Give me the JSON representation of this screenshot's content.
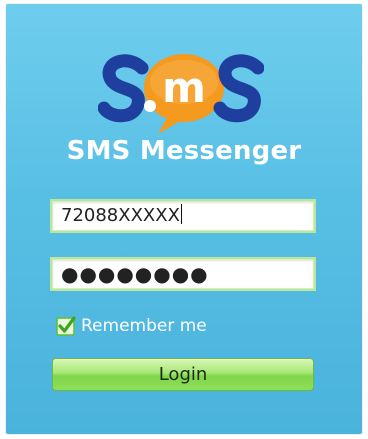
{
  "app": {
    "title": "SMS Messenger",
    "logo_text": "S.mS"
  },
  "login_form": {
    "phone_value": "72088XXXXX",
    "password_masked": "●●●●●●●●",
    "remember_label": "Remember me",
    "remember_checked": true,
    "login_label": "Login"
  },
  "colors": {
    "background": "#58bfe4",
    "logo_dark_blue": "#1f3f9e",
    "logo_orange": "#f49a1e",
    "button_green": "#8fde5a",
    "checkbox_green": "#5fbf2f"
  }
}
